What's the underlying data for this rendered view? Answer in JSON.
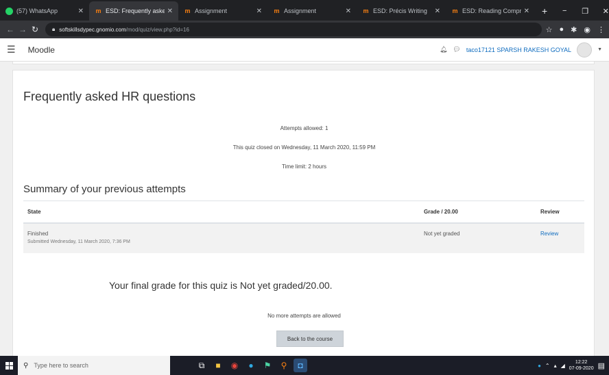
{
  "browser": {
    "tabs": [
      {
        "label": "(57) WhatsApp",
        "favicon": "whatsapp-icon",
        "active": false
      },
      {
        "label": "ESD: Frequently asked",
        "favicon": "moodle-icon",
        "active": true
      },
      {
        "label": "Assignment",
        "favicon": "moodle-icon",
        "active": false
      },
      {
        "label": "Assignment",
        "favicon": "moodle-icon",
        "active": false
      },
      {
        "label": "ESD: Précis Writing",
        "favicon": "moodle-icon",
        "active": false
      },
      {
        "label": "ESD: Reading Comprehe...",
        "favicon": "moodle-icon",
        "active": false
      }
    ],
    "url_host": "softskillsdypec.gnomio.com",
    "url_path": "/mod/quiz/view.php?id=16"
  },
  "moodle_nav": {
    "brand": "Moodle",
    "user_name": "taco17121 SPARSH RAKESH GOYAL"
  },
  "quiz": {
    "title": "Frequently asked HR questions",
    "attempts_allowed": "Attempts allowed: 1",
    "closed_on": "This quiz closed on Wednesday, 11 March 2020, 11:59 PM",
    "time_limit": "Time limit: 2 hours",
    "summary_heading": "Summary of your previous attempts",
    "table": {
      "headers": [
        "State",
        "Grade / 20.00",
        "Review"
      ],
      "rows": [
        {
          "state": "Finished",
          "submitted": "Submitted Wednesday, 11 March 2020, 7:36 PM",
          "grade": "Not yet graded",
          "review": "Review"
        }
      ]
    },
    "final_grade": "Your final grade for this quiz is Not yet graded/20.00.",
    "no_more": "No more attempts are allowed",
    "back_button": "Back to the course"
  },
  "taskbar": {
    "search_placeholder": "Type here to search",
    "time": "12:22",
    "date": "07-09-2020"
  },
  "colors": {
    "link": "#0f6cbf",
    "moodle_orange": "#f98012"
  }
}
